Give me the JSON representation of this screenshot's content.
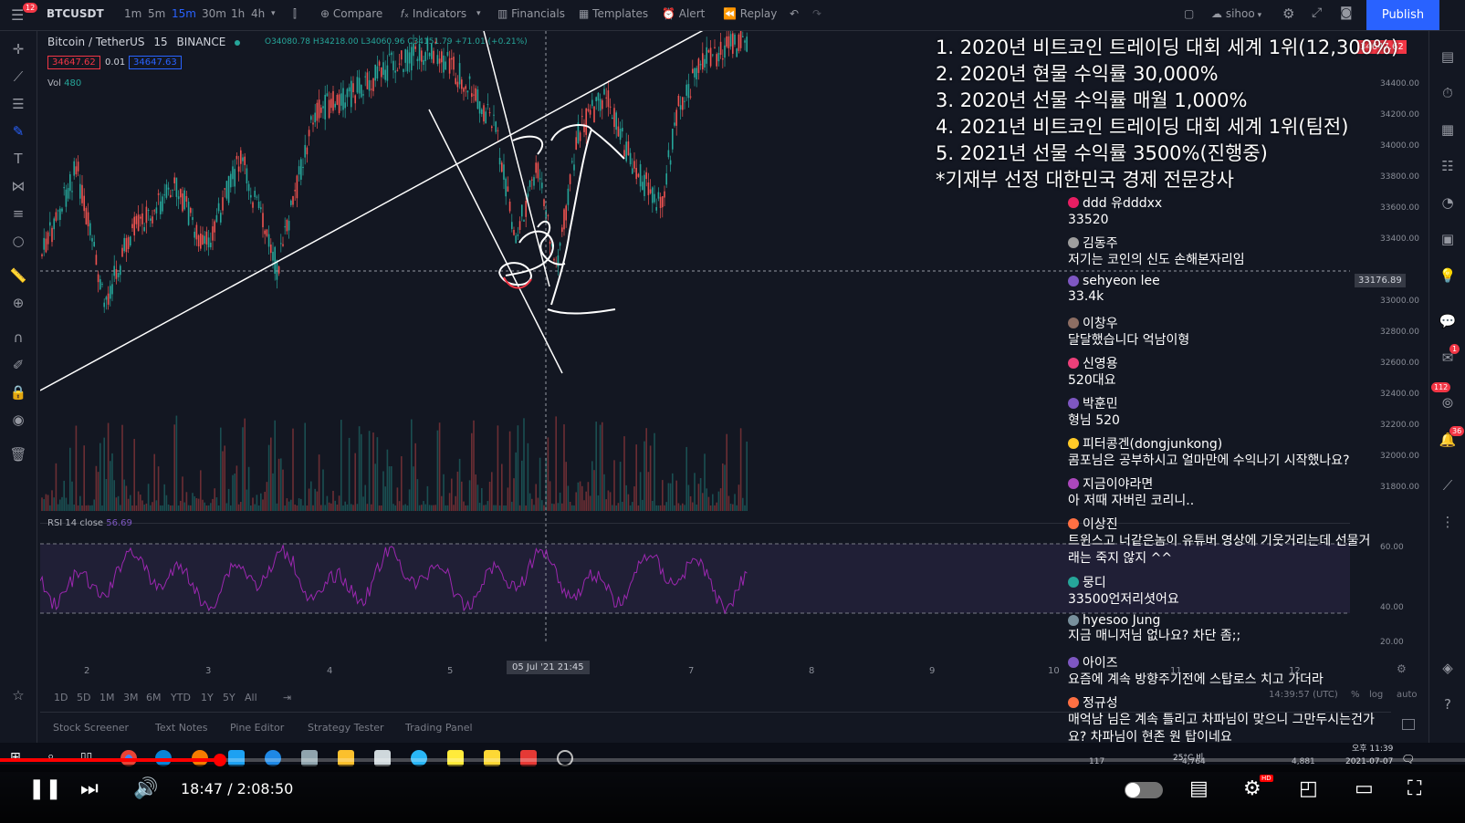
{
  "toolbar": {
    "notification_count": "12",
    "symbol": "BTCUSDT",
    "intervals": [
      "1m",
      "5m",
      "15m",
      "30m",
      "1h",
      "4h"
    ],
    "active_interval": "15m",
    "compare": "Compare",
    "indicators": "Indicators",
    "financials": "Financials",
    "templates": "Templates",
    "alert": "Alert",
    "replay": "Replay",
    "layout_name": "sihoo",
    "publish": "Publish"
  },
  "chart": {
    "title": "Bitcoin / TetherUS",
    "interval": "15",
    "exchange": "BINANCE",
    "ohlc": "O34080.78 H34218.00 L34060.96 C34151.79 +71.01 (+0.21%)",
    "bid": "34647.62",
    "spread": "0.01",
    "ask": "34647.63",
    "volume_label": "Vol",
    "volume_value": "480",
    "rsi_label": "RSI 14 close",
    "rsi_value": "56.69",
    "price_axis": [
      "34400.00",
      "34200.00",
      "34000.00",
      "33800.00",
      "33600.00",
      "33400.00",
      "33000.00",
      "32800.00",
      "32600.00",
      "32400.00",
      "32200.00",
      "32000.00",
      "31800.00"
    ],
    "crosshair_price": "33176.89",
    "current_price_tag": "34647.62",
    "rsi_axis": [
      "60.00",
      "40.00",
      "20.00"
    ],
    "time_axis": [
      "2",
      "3",
      "4",
      "5",
      "7",
      "8",
      "9",
      "10",
      "11",
      "12"
    ],
    "crosshair_time": "05 Jul '21  21:45",
    "range_buttons": [
      "1D",
      "5D",
      "1M",
      "3M",
      "6M",
      "YTD",
      "1Y",
      "5Y",
      "All"
    ],
    "clock": "14:39:57 (UTC)",
    "scale_options": [
      "%",
      "log",
      "auto"
    ],
    "bottom_tabs": [
      "Stock Screener",
      "Text Notes",
      "Pine Editor",
      "Strategy Tester",
      "Trading Panel"
    ]
  },
  "overlay": {
    "achievements": [
      "1. 2020년 비트코인 트레이딩 대회 세계 1위(12,300%)",
      "2. 2020년 현물 수익률 30,000%",
      "3. 2020년 선물 수익률 매월 1,000%",
      "4. 2021년 비트코인 트레이딩 대회 세계 1위(팀전)",
      "5. 2021년 선물 수익률 3500%(진행중)",
      "*기재부 선정 대한민국 경제 전문강사"
    ]
  },
  "chat": [
    {
      "author": "ddd 유dddxx",
      "text": "33520",
      "color": "#e91e63"
    },
    {
      "author": "김동주",
      "text": "저기는 코인의 신도 손해본자리임",
      "color": "#9e9e9e"
    },
    {
      "author": "sehyeon lee",
      "text": "33.4k",
      "color": "#7e57c2"
    },
    {
      "author": "이창우",
      "text": "달달했습니다 억남이형",
      "color": "#8d6e63"
    },
    {
      "author": "신영용",
      "text": "520대요",
      "color": "#ec407a"
    },
    {
      "author": "박훈민",
      "text": "형님 520",
      "color": "#7e57c2"
    },
    {
      "author": "피터콩겐(dongjunkong)",
      "text": "콤포님은 공부하시고 얼마만에 수익나기 시작했나요?",
      "color": "#ffca28"
    },
    {
      "author": "지금이야라면",
      "text": "아 저때 자버린 코리니..",
      "color": "#ab47bc"
    },
    {
      "author": "이상진",
      "text": "트윈스고 너같은놈이 유튜버 영상에 기웃거리는데 선물거래는 죽지 않지 ^^",
      "color": "#ff7043"
    },
    {
      "author": "뭉디",
      "text": "33500언저리셧어요",
      "color": "#26a69a"
    },
    {
      "author": "hyesoo Jung",
      "text": "지금 매니저님 없나요? 차단 좀;;",
      "color": "#78909c"
    },
    {
      "author": "아이즈",
      "text": "요즘에 계속 방향주기전에 스탑로스 치고 가더라",
      "color": "#7e57c2"
    },
    {
      "author": "정규성",
      "text": "매억남 님은 계속 틀리고 차파님이 맞으니 그만두시는건가요? 차파님이 현존 원 탑이네요",
      "color": "#ff7043"
    }
  ],
  "right_badges": {
    "a": "1",
    "b": "112",
    "c": "36"
  },
  "taskbar": {
    "weather": "25°C 비",
    "count_left": "117",
    "count_mid": "4,764",
    "count_right": "4,881",
    "time": "오후 11:39",
    "date": "2021-07-07"
  },
  "player": {
    "time": "18:47 / 2:08:50",
    "progress": 0.15
  }
}
